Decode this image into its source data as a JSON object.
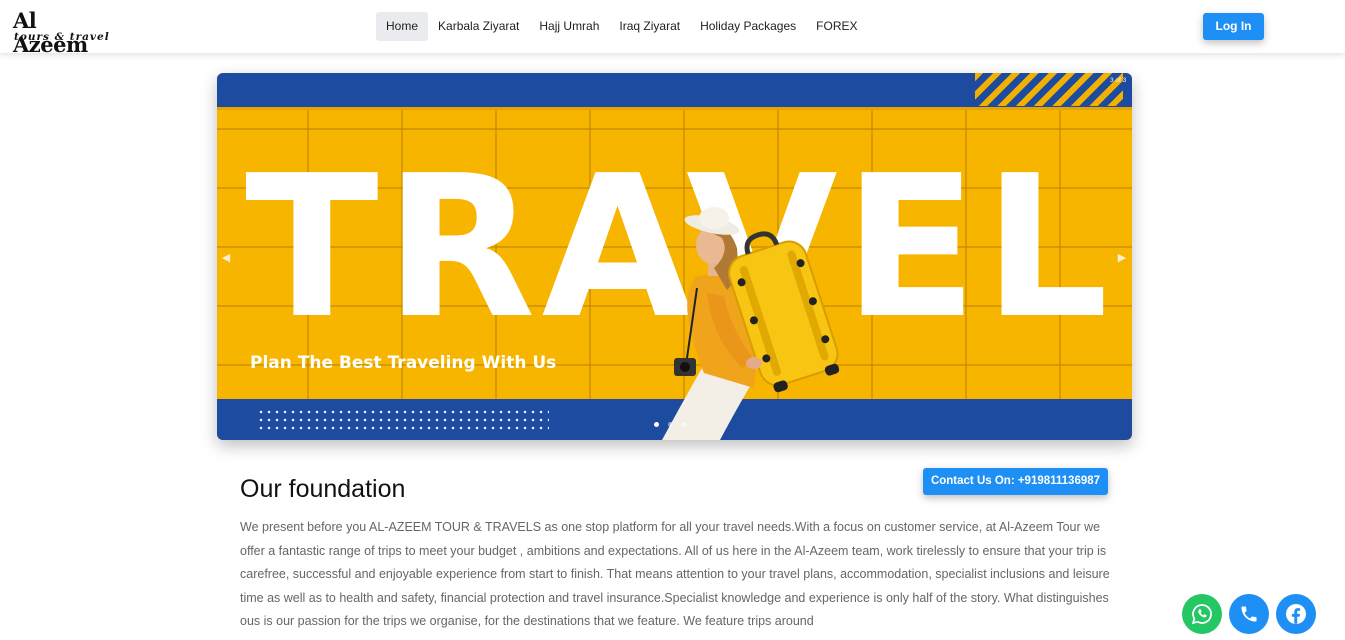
{
  "brand": {
    "name": "Al Azeem",
    "tagline": "tours & travel"
  },
  "nav": {
    "items": [
      {
        "label": "Home",
        "active": true
      },
      {
        "label": "Karbala Ziyarat"
      },
      {
        "label": "Hajj Umrah"
      },
      {
        "label": "Iraq Ziyarat"
      },
      {
        "label": "Holiday Packages"
      },
      {
        "label": "FOREX"
      }
    ],
    "login_label": "Log In"
  },
  "hero": {
    "headline": "TRAVEL.",
    "tagline": "Plan The Best Traveling With Us",
    "slide_counter": "3 of 3",
    "slides_total": 3,
    "active_slide": 1,
    "prev_icon": "chevron-left-icon",
    "next_icon": "chevron-right-icon",
    "colors": {
      "yellow": "#f7b500",
      "blue": "#1c4ba0"
    }
  },
  "contact": {
    "label": "Contact Us On: +919811136987"
  },
  "foundation": {
    "title": "Our foundation",
    "body": "We present before you AL-AZEEM TOUR & TRAVELS as one stop platform for all your travel needs.With a focus on customer service, at Al-Azeem Tour we offer a fantastic range of trips to meet your budget , ambitions and expectations. All of us here in the Al-Azeem team, work tirelessly to ensure that your trip is carefree, successful and enjoyable experience from start to finish. That means attention to your travel plans, accommodation, specialist inclusions and leisure time as well as to health and safety, financial protection and travel insurance.Specialist knowledge and experience is only half of the story. What distinguishes ous is our passion for the trips we organise, for the destinations that we feature. We feature trips around"
  },
  "social": [
    {
      "icon": "whatsapp-icon",
      "color": "#25c765"
    },
    {
      "icon": "phone-icon",
      "color": "#1e8ff5"
    },
    {
      "icon": "facebook-icon",
      "color": "#1e8ff5"
    }
  ]
}
